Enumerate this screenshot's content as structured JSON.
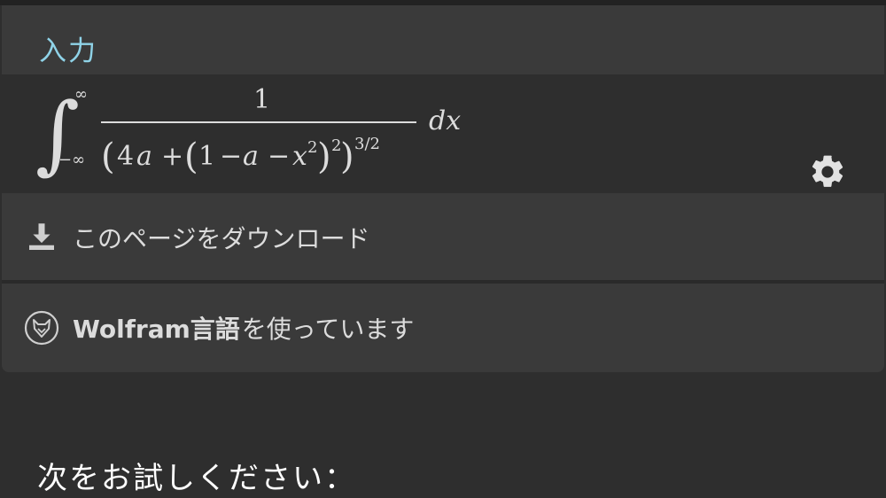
{
  "input_section": {
    "label": "入力",
    "formula": {
      "upper_limit": "∞",
      "lower_limit": "−∞",
      "numerator": "1",
      "denominator": "(4a + (1 − a − x²)²)^(3/2)",
      "differential": "dx"
    }
  },
  "download": {
    "label": "このページをダウンロード",
    "icon": "download-icon"
  },
  "wolfram": {
    "bold_label": "Wolfram言語",
    "label_suffix": "を使っています",
    "icon": "wolfram-wolf-icon"
  },
  "settings": {
    "icon": "gear-icon"
  },
  "try_prompt": "次をお試しください："
}
